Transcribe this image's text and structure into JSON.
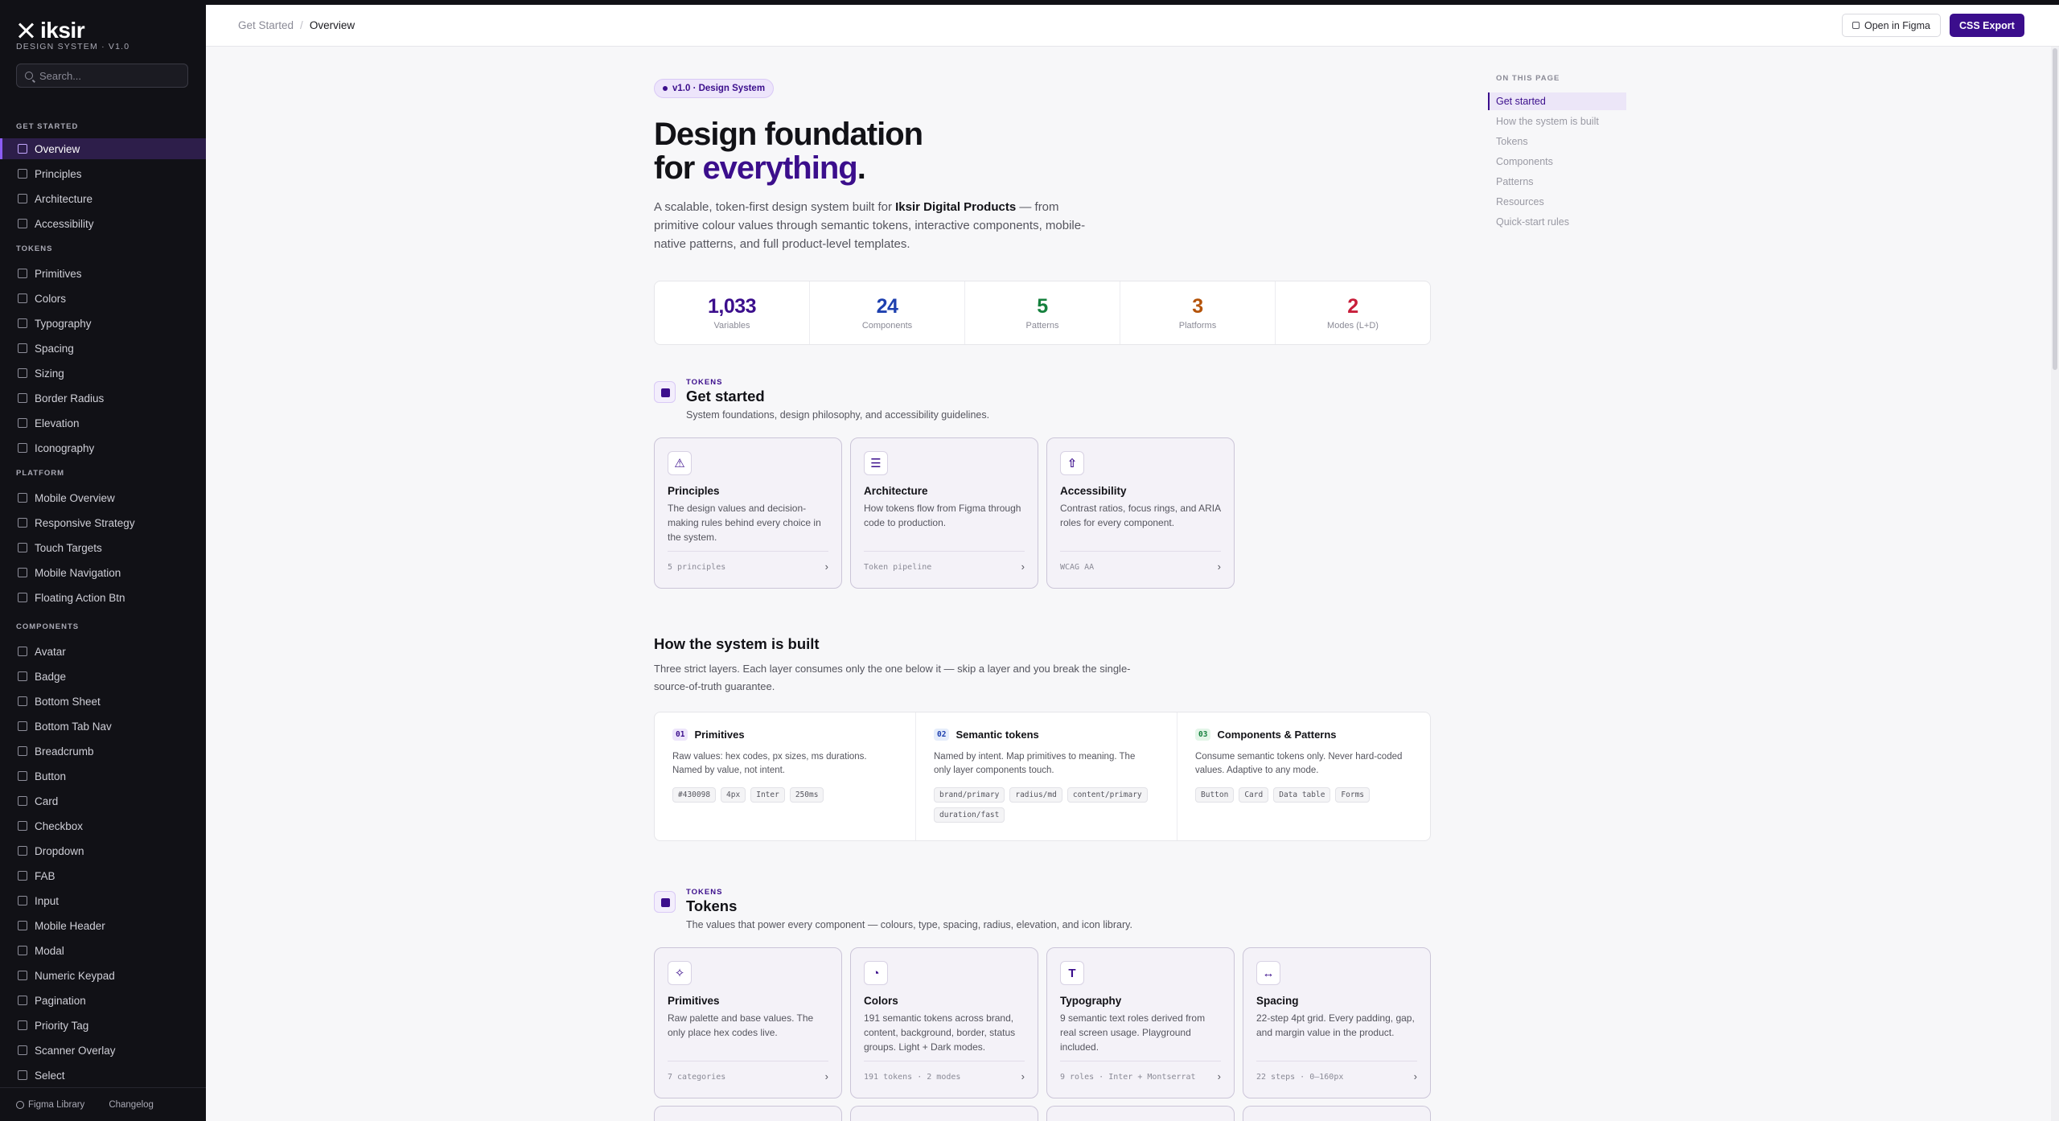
{
  "brand": {
    "name": "iksir",
    "subtitle": "DESIGN SYSTEM · V1.0"
  },
  "search": {
    "placeholder": "Search..."
  },
  "sidebar": {
    "groups": [
      {
        "title": "GET STARTED",
        "items": [
          "Overview",
          "Principles",
          "Architecture",
          "Accessibility"
        ]
      },
      {
        "title": "TOKENS",
        "items": [
          "Primitives",
          "Colors",
          "Typography",
          "Spacing",
          "Sizing",
          "Border Radius",
          "Elevation",
          "Iconography"
        ]
      },
      {
        "title": "PLATFORM",
        "items": [
          "Mobile Overview",
          "Responsive Strategy",
          "Touch Targets",
          "Mobile Navigation",
          "Floating Action Btn"
        ]
      },
      {
        "title": "COMPONENTS",
        "items": [
          "Avatar",
          "Badge",
          "Bottom Sheet",
          "Bottom Tab Nav",
          "Breadcrumb",
          "Button",
          "Card",
          "Checkbox",
          "Dropdown",
          "FAB",
          "Input",
          "Mobile Header",
          "Modal",
          "Numeric Keypad",
          "Pagination",
          "Priority Tag",
          "Scanner Overlay",
          "Select"
        ]
      }
    ],
    "active_item": "Overview",
    "footer": {
      "figma_library": "Figma Library",
      "changelog": "Changelog"
    }
  },
  "header": {
    "breadcrumb": [
      "Get Started",
      "Overview"
    ],
    "open_figma": "Open in Figma",
    "css_export": "CSS Export"
  },
  "hero": {
    "pill": "v1.0 · Design System",
    "title_line1": "Design foundation",
    "title_for": "for ",
    "title_accent": "everything",
    "title_dot": ".",
    "desc_pre": "A scalable, token-first design system built for ",
    "desc_brand": "Iksir Digital Products",
    "desc_post": " — from primitive colour values through semantic tokens, interactive components, mobile-native patterns, and full product-level templates."
  },
  "stats": [
    {
      "value": "1,033",
      "label": "Variables",
      "color": "#3b0e8c"
    },
    {
      "value": "24",
      "label": "Components",
      "color": "#1e40af"
    },
    {
      "value": "5",
      "label": "Patterns",
      "color": "#15803d"
    },
    {
      "value": "3",
      "label": "Platforms",
      "color": "#b45309"
    },
    {
      "value": "2",
      "label": "Modes (L+D)",
      "color": "#c81e3a"
    }
  ],
  "get_started": {
    "kicker": "TOKENS",
    "title": "Get started",
    "desc": "System foundations, design philosophy, and accessibility guidelines.",
    "cards": [
      {
        "icon": "warning-triangle-icon",
        "glyph": "⚠",
        "title": "Principles",
        "desc": "The design values and decision-making rules behind every choice in the system.",
        "footer": "5 principles"
      },
      {
        "icon": "layers-stack-icon",
        "glyph": "☰",
        "title": "Architecture",
        "desc": "How tokens flow from Figma through code to production.",
        "footer": "Token pipeline"
      },
      {
        "icon": "accessibility-icon",
        "glyph": "⇧",
        "title": "Accessibility",
        "desc": "Contrast ratios, focus rings, and ARIA roles for every component.",
        "footer": "WCAG AA"
      }
    ]
  },
  "how": {
    "title": "How the system is built",
    "desc": "Three strict layers. Each layer consumes only the one below it — skip a layer and you break the single-source-of-truth guarantee.",
    "layers": [
      {
        "num": "01",
        "name": "Primitives",
        "desc": "Raw values: hex codes, px sizes, ms durations. Named by value, not intent.",
        "chips": [
          "#430098",
          "4px",
          "Inter",
          "250ms"
        ],
        "num_color": "#3b0e8c",
        "num_bg": "#ede5fb"
      },
      {
        "num": "02",
        "name": "Semantic tokens",
        "desc": "Named by intent. Map primitives to meaning. The only layer components touch.",
        "chips": [
          "brand/primary",
          "radius/md",
          "content/primary",
          "duration/fast"
        ],
        "num_color": "#1e40af",
        "num_bg": "#e5edfb"
      },
      {
        "num": "03",
        "name": "Components & Patterns",
        "desc": "Consume semantic tokens only. Never hard-coded values. Adaptive to any mode.",
        "chips": [
          "Button",
          "Card",
          "Data table",
          "Forms"
        ],
        "num_color": "#15803d",
        "num_bg": "#e3f5e8"
      }
    ]
  },
  "tokens": {
    "kicker": "TOKENS",
    "title": "Tokens",
    "desc": "The values that power every component — colours, type, spacing, radius, elevation, and icon library.",
    "cards": [
      {
        "icon": "sparkle-icon",
        "glyph": "✧",
        "title": "Primitives",
        "desc": "Raw palette and base values. The only place hex codes live.",
        "footer": "7 categories"
      },
      {
        "icon": "palette-icon",
        "glyph": "◔",
        "title": "Colors",
        "desc": "191 semantic tokens across brand, content, background, border, status groups. Light + Dark modes.",
        "footer": "191 tokens · 2 modes"
      },
      {
        "icon": "typography-icon",
        "glyph": "T",
        "title": "Typography",
        "desc": "9 semantic text roles derived from real screen usage. Playground included.",
        "footer": "9 roles · Inter + Montserrat"
      },
      {
        "icon": "spacing-arrows-icon",
        "glyph": "↔",
        "title": "Spacing",
        "desc": "22-step 4pt grid. Every padding, gap, and margin value in the product.",
        "footer": "22 steps · 0–160px"
      }
    ]
  },
  "toc": {
    "title": "ON THIS PAGE",
    "items": [
      "Get started",
      "How the system is built",
      "Tokens",
      "Components",
      "Patterns",
      "Resources",
      "Quick-start rules"
    ],
    "active": "Get started"
  }
}
